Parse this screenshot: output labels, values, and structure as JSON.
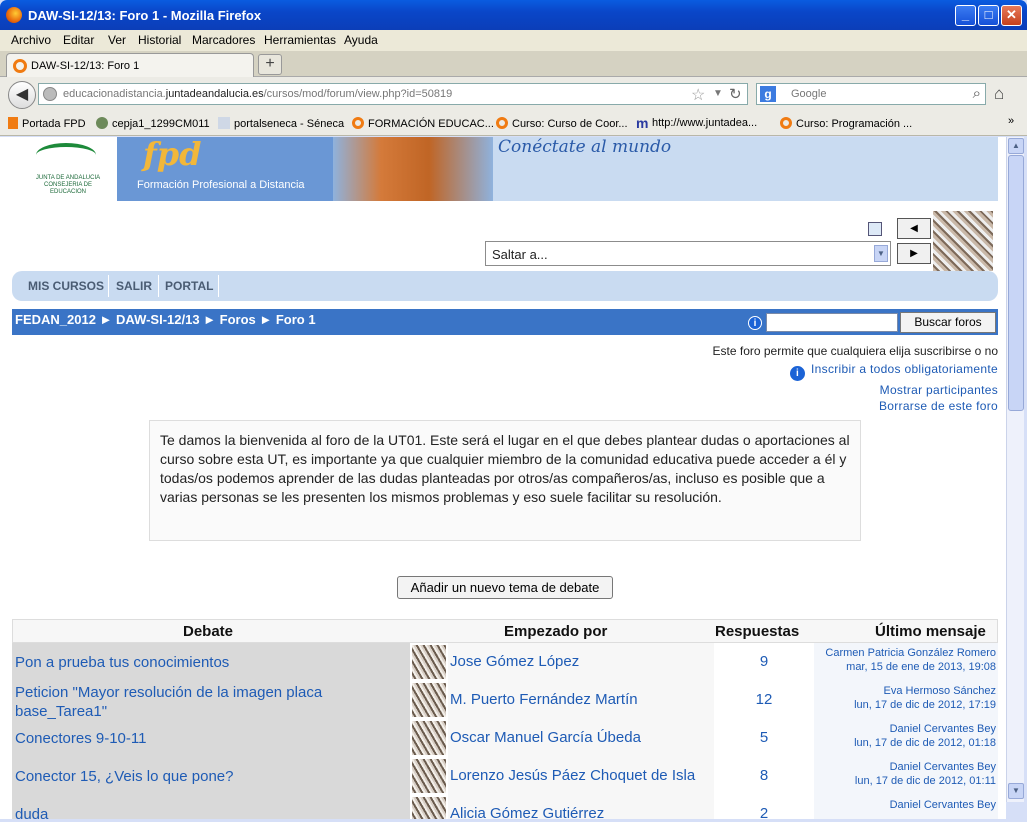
{
  "window": {
    "title": "DAW-SI-12/13: Foro 1 - Mozilla Firefox"
  },
  "menu": [
    "Archivo",
    "Editar",
    "Ver",
    "Historial",
    "Marcadores",
    "Herramientas",
    "Ayuda"
  ],
  "tab": {
    "label": "DAW-SI-12/13: Foro 1",
    "new_tab": "+"
  },
  "nav": {
    "url_host_pre": "educacionadistancia.",
    "url_host_main": "juntadeandalucia.es",
    "url_path": "/cursos/mod/forum/view.php?id=50819",
    "search_placeholder": "Google"
  },
  "bookmarks": [
    "Portada FPD",
    "cepja1_1299CM011",
    "portalseneca - Séneca",
    "FORMACIÓN EDUCAC...",
    "Curso: Curso de Coor...",
    "http://www.juntadea...",
    "Curso: Programación ..."
  ],
  "banner": {
    "fpd": "fpd",
    "fpd_sub": "Formación Profesional a Distancia",
    "slogan": "Conéctate al mundo",
    "junta_text": "JUNTA DE ANDALUCIA CONSEJERIA DE EDUCACION"
  },
  "jump": {
    "value": "Saltar a..."
  },
  "mainmenu": [
    "MIS CURSOS",
    "SALIR",
    "PORTAL"
  ],
  "breadcrumb": "FEDAN_2012 ► DAW-SI-12/13 ► Foros ► Foro 1",
  "search_forums_button": "Buscar foros",
  "subscription": {
    "notice": "Este foro permite que cualquiera elija suscribirse o no",
    "force": "Inscribir a todos obligatoriamente",
    "show": "Mostrar participantes",
    "unsubscribe": "Borrarse de este foro"
  },
  "intro": "Te damos la bienvenida al foro de la UT01. Este será el lugar en el que debes plantear dudas o aportaciones al curso sobre esta UT, es importante ya que cualquier miembro de la comunidad educativa puede acceder a él y todas/os podemos aprender de las dudas planteadas por otros/as compañeros/as, incluso es posible que a varias personas se les presenten los mismos problemas y eso suele facilitar su resolución.",
  "add_topic_button": "Añadir un nuevo tema de debate",
  "table": {
    "headers": [
      "Debate",
      "Empezado por",
      "Respuestas",
      "Último mensaje"
    ],
    "rows": [
      {
        "topic": "Pon a prueba tus conocimientos",
        "author": "Jose Gómez López",
        "replies": "9",
        "last_author": "Carmen Patricia González Romero",
        "last_date": "mar, 15 de ene de 2013, 19:08"
      },
      {
        "topic": "Peticion \"Mayor resolución de la imagen placa base_Tarea1\"",
        "author": "M. Puerto Fernández Martín",
        "replies": "12",
        "last_author": "Eva Hermoso Sánchez",
        "last_date": "lun, 17 de dic de 2012, 17:19"
      },
      {
        "topic": "Conectores 9-10-11",
        "author": "Oscar Manuel García Úbeda",
        "replies": "5",
        "last_author": "Daniel Cervantes Bey",
        "last_date": "lun, 17 de dic de 2012, 01:18"
      },
      {
        "topic": "Conector 15, ¿Veis lo que pone?",
        "author": "Lorenzo Jesús Páez Choquet de Isla",
        "replies": "8",
        "last_author": "Daniel Cervantes Bey",
        "last_date": "lun, 17 de dic de 2012, 01:11"
      },
      {
        "topic": "duda",
        "author": "Alicia Gómez Gutiérrez",
        "replies": "2",
        "last_author": "Daniel Cervantes Bey",
        "last_date": ""
      }
    ]
  }
}
